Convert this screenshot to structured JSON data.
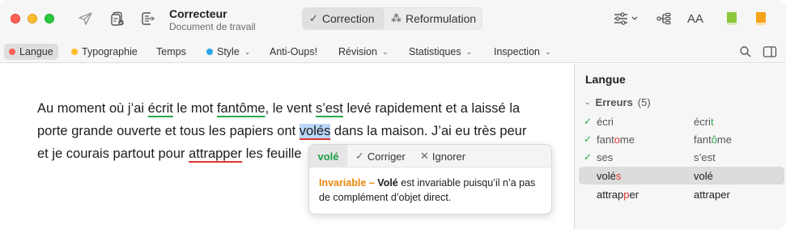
{
  "app": {
    "title": "Correcteur",
    "subtitle": "Document de travail"
  },
  "toolbar": {
    "send_icon": "paper-plane-icon",
    "check_doc_icon": "check-document-icon",
    "export_icon": "export-document-icon",
    "mode_tabs": [
      {
        "label": "Correction",
        "glyph": "✓",
        "active": true
      },
      {
        "label": "Reformulation",
        "glyph": "⁂",
        "active": false
      }
    ],
    "right_icons": [
      "sliders-icon",
      "outline-tree-icon",
      "font-size-icon",
      "green-book-icon",
      "orange-book-icon"
    ],
    "font_size_label": "AA"
  },
  "subtabs": [
    {
      "label": "Langue",
      "dot": "#ff5f57",
      "active": true,
      "chevron": false
    },
    {
      "label": "Typographie",
      "dot": "#febc2e",
      "active": false,
      "chevron": false
    },
    {
      "label": "Temps",
      "dot": "",
      "active": false,
      "chevron": false
    },
    {
      "label": "Style",
      "dot": "#2aa5e8",
      "active": false,
      "chevron": true
    },
    {
      "label": "Anti-Oups!",
      "dot": "",
      "active": false,
      "chevron": false
    },
    {
      "label": "Révision",
      "dot": "",
      "active": false,
      "chevron": true
    },
    {
      "label": "Statistiques",
      "dot": "",
      "active": false,
      "chevron": true
    },
    {
      "label": "Inspection",
      "dot": "",
      "active": false,
      "chevron": true
    }
  ],
  "document": {
    "line1": {
      "t1": "Au moment où j’ai ",
      "w1": "écrit",
      "t2": " le mot ",
      "w2": "fantôme",
      "t3": ", le vent ",
      "w3": "s’est",
      "t4": " levé rapidement et a laissé la"
    },
    "line2": {
      "t1": "porte grande ouverte et tous les papiers ont ",
      "w1": "volés",
      "t2": " dans la maison. J’ai eu très peur"
    },
    "line3": {
      "t1": "et je courais partout pour ",
      "w1": "attrapper",
      "t2": " les feuille"
    }
  },
  "popover": {
    "word": "volé",
    "correct_label": "Corriger",
    "ignore_label": "Ignorer",
    "type_label": "Invariable –",
    "strong_word": "Volé",
    "message": " est invariable puisqu’il n’a pas de complément d’objet direct."
  },
  "sidebar": {
    "title": "Langue",
    "group_label": "Erreurs",
    "group_count": "(5)",
    "rows": [
      {
        "err_a": "écri",
        "err_b": "",
        "err_c": "",
        "fix_a": "écri",
        "fix_b": "t",
        "fix_c": "",
        "done": true,
        "selected": false
      },
      {
        "err_a": "fant",
        "err_b": "o",
        "err_c": "me",
        "fix_a": "fant",
        "fix_b": "ô",
        "fix_c": "me",
        "done": true,
        "selected": false
      },
      {
        "err_a": "ses",
        "err_b": "",
        "err_c": "",
        "fix_a": "s’est",
        "fix_b": "",
        "fix_c": "",
        "done": true,
        "selected": false
      },
      {
        "err_a": "volé",
        "err_b": "s",
        "err_c": "",
        "fix_a": "volé",
        "fix_b": "",
        "fix_c": "",
        "done": false,
        "selected": true
      },
      {
        "err_a": "attrap",
        "err_b": "p",
        "err_c": "er",
        "fix_a": "attraper",
        "fix_b": "",
        "fix_c": "",
        "done": false,
        "selected": false
      }
    ]
  },
  "colors": {
    "accent_green": "#2aa84a",
    "error_red": "#e0342f",
    "warning_orange": "#e8870e",
    "selection_blue": "#b9d7f7"
  }
}
